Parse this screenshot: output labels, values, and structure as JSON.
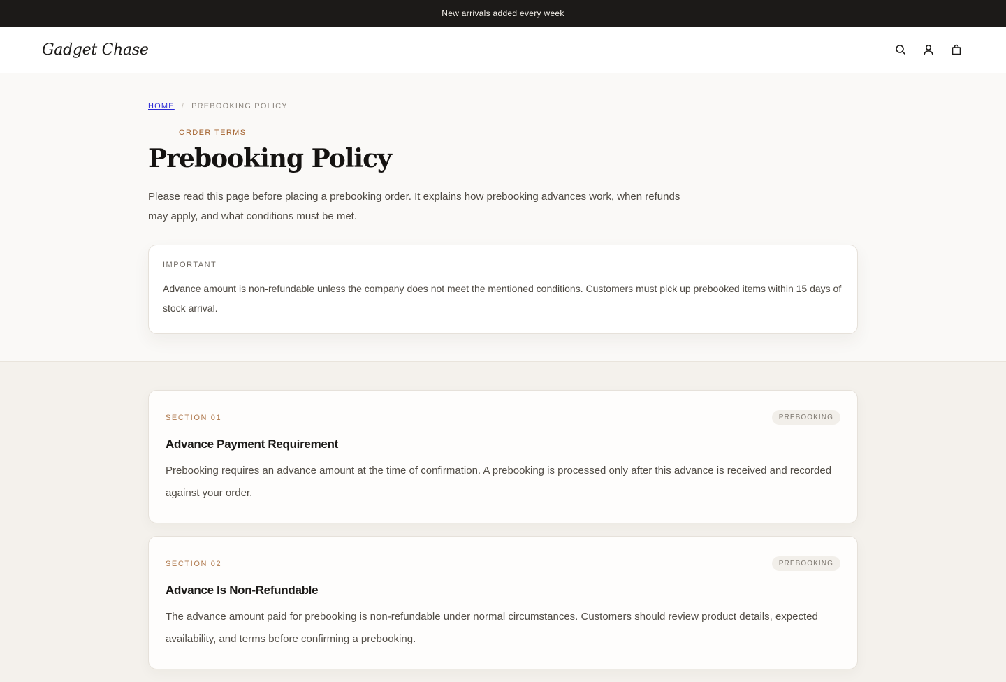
{
  "announcement": "New arrivals added every week",
  "brand": {
    "name": "Gadget Chase"
  },
  "header": {
    "icons": [
      "search-icon",
      "user-icon",
      "shopping-bag-icon"
    ]
  },
  "breadcrumb": {
    "home": "HOME",
    "separator": "/",
    "current": "PREBOOKING POLICY"
  },
  "eyebrow": "ORDER TERMS",
  "title": "Prebooking Policy",
  "intro": "Please read this page before placing a prebooking order. It explains how prebooking advances work, when refunds may apply, and what conditions must be met.",
  "notice": {
    "label": "IMPORTANT",
    "text": "Advance amount is non-refundable unless the company does not meet the mentioned conditions. Customers must pick up prebooked items within 15 days of stock arrival."
  },
  "sections": [
    {
      "number": "SECTION 01",
      "badge": "PREBOOKING",
      "title": "Advance Payment Requirement",
      "text": "Prebooking requires an advance amount at the time of confirmation. A prebooking is processed only after this advance is received and recorded against your order."
    },
    {
      "number": "SECTION 02",
      "badge": "PREBOOKING",
      "title": "Advance Is Non-Refundable",
      "text": "The advance amount paid for prebooking is non-refundable under normal circumstances. Customers should review product details, expected availability, and terms before confirming a prebooking."
    }
  ],
  "colors": {
    "accent": "#a25f2a",
    "announcement_bg": "#1c1a18",
    "page_bg": "#f4f1ec"
  }
}
